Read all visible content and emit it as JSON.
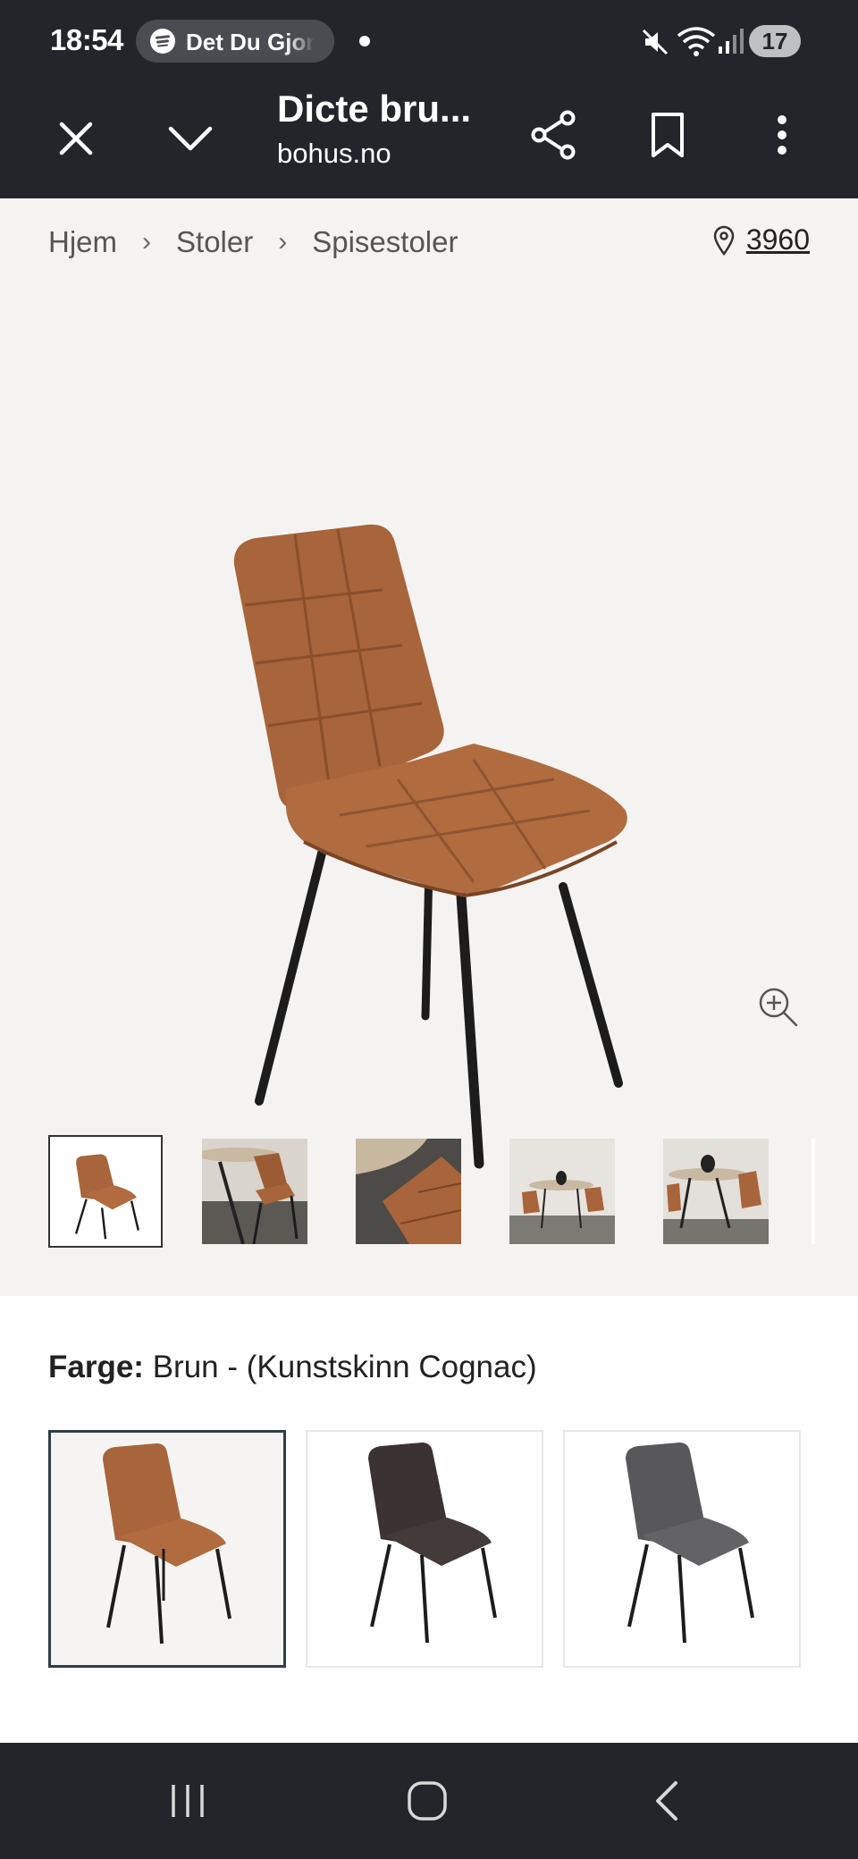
{
  "status_bar": {
    "time": "18:54",
    "media_text": "Det Du Gjor",
    "battery": "17"
  },
  "browser": {
    "page_title": "Dicte bru...",
    "domain": "bohus.no",
    "icons": [
      "close-icon",
      "chevron-down-icon",
      "share-icon",
      "bookmark-icon",
      "more-vertical-icon"
    ]
  },
  "breadcrumb": [
    "Hjem",
    "Stoler",
    "Spisestoler"
  ],
  "location": {
    "postcode": "3960",
    "icon": "location-pin-icon"
  },
  "gallery": {
    "thumbnail_count": 5,
    "selected_index": 0
  },
  "color_selector": {
    "label": "Farge:",
    "value": "Brun - (Kunstskinn Cognac)",
    "options": [
      {
        "name": "cognac",
        "color": "#a8643a",
        "selected": true
      },
      {
        "name": "black",
        "color": "#3a3332",
        "selected": false
      },
      {
        "name": "grey",
        "color": "#58585a",
        "selected": false
      }
    ]
  },
  "colors": {
    "bar_bg": "#23252b",
    "product_bg": "#f5f3f1",
    "leather": "#a8643a"
  }
}
